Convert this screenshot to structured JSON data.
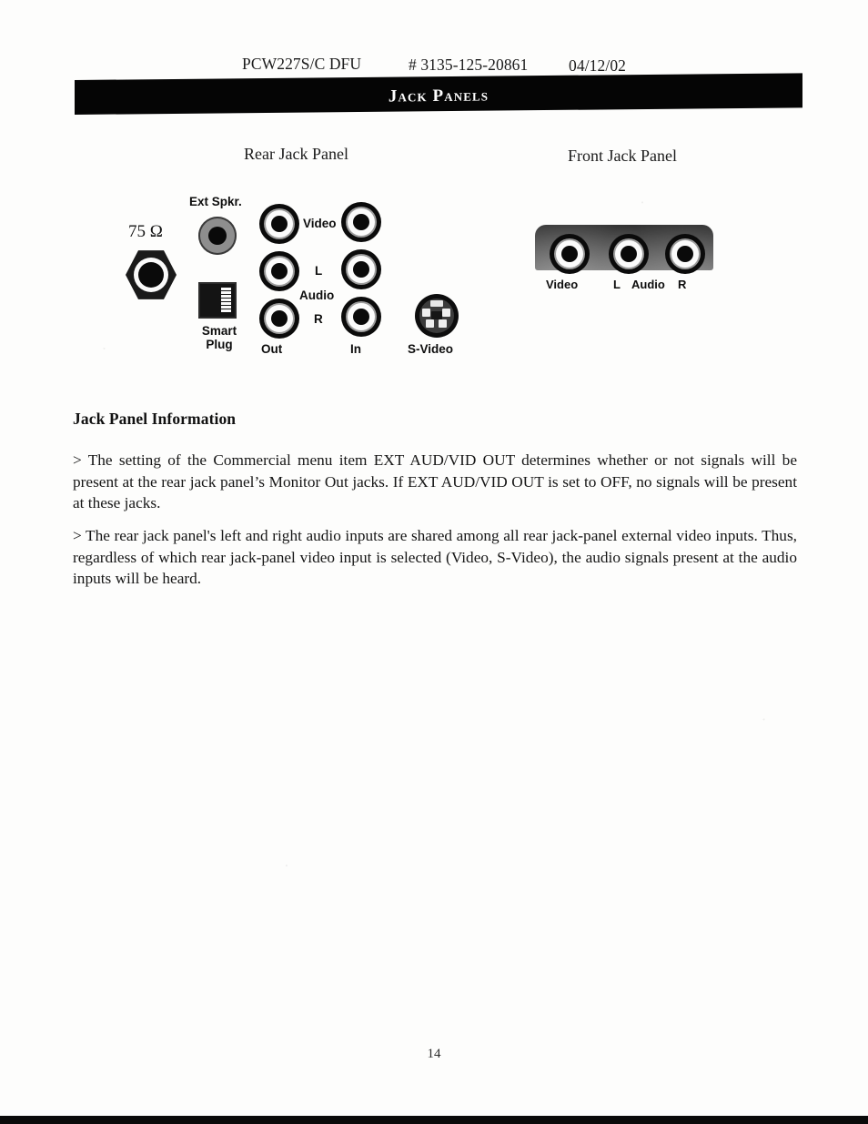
{
  "running_head": {
    "model": "PCW227S/C DFU",
    "part_number": "# 3135-125-20861",
    "date": "04/12/02"
  },
  "banner": {
    "title": "Jack Panels"
  },
  "captions": {
    "rear": "Rear Jack Panel",
    "front": "Front Jack Panel"
  },
  "rear_panel": {
    "antenna_label": "75 Ω",
    "ext_speaker_label": "Ext Spkr.",
    "smart_plug_label_line1": "Smart",
    "smart_plug_label_line2": "Plug",
    "video_label": "Video",
    "left_label": "L",
    "audio_label": "Audio",
    "right_label": "R",
    "out_label": "Out",
    "in_label": "In",
    "svideo_label": "S-Video"
  },
  "front_panel": {
    "video_label": "Video",
    "left_label": "L",
    "audio_label": "Audio",
    "right_label": "R"
  },
  "content": {
    "section_heading": "Jack Panel Information",
    "paragraph_1": "> The setting of the Commercial menu item EXT AUD/VID OUT determines whether or not signals will be present at the rear jack panel’s Monitor Out jacks.  If EXT AUD/VID OUT is set to OFF, no signals will be present at these jacks.",
    "paragraph_2": "> The rear jack panel's left and right audio inputs are shared among all rear jack-panel external video inputs. Thus, regardless of which rear jack-panel video input is selected (Video, S-Video), the audio signals present at the audio inputs will be heard."
  },
  "footer": {
    "page_number": "14"
  },
  "colors": {
    "banner_background": "#050505",
    "banner_text": "#ffffff",
    "page_background": "#fdfdfc",
    "body_text": "#161616"
  }
}
